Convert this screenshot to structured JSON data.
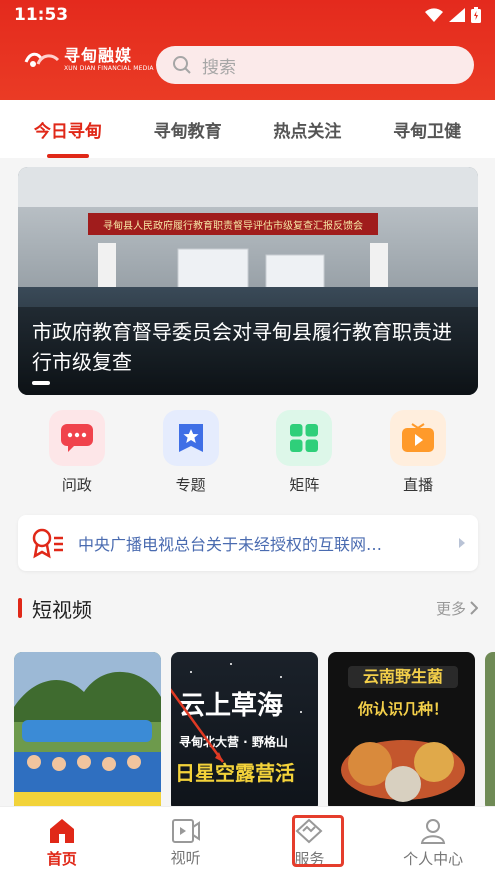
{
  "status": {
    "time": "11:53"
  },
  "header": {
    "logo_main": "寻甸融媒",
    "logo_sub": "XUN DIAN FINANCIAL MEDIA",
    "search_placeholder": "搜索"
  },
  "tabs": [
    {
      "label": "今日寻甸",
      "active": true
    },
    {
      "label": "寻甸教育",
      "active": false
    },
    {
      "label": "热点关注",
      "active": false
    },
    {
      "label": "寻甸卫健",
      "active": false
    }
  ],
  "banner": {
    "caption": "市政府教育督导委员会对寻甸县履行教育职责进行市级复查",
    "screen_text": "寻甸县人民政府履行教育职责督导评估市级复查汇报反馈会"
  },
  "quick_links": [
    {
      "label": "问政",
      "icon": "message-icon",
      "color": "#f0434c"
    },
    {
      "label": "专题",
      "icon": "star-bookmark-icon",
      "color": "#3f6fe6"
    },
    {
      "label": "矩阵",
      "icon": "grid-icon",
      "color": "#2fcf7a"
    },
    {
      "label": "直播",
      "icon": "live-play-icon",
      "color": "#ff9a2a"
    }
  ],
  "notice": {
    "text": "中央广播电视总台关于未经授权的互联网…"
  },
  "short_video": {
    "title": "短视频",
    "more": "更多",
    "cards": [
      {
        "overlay": ""
      },
      {
        "overlay_line1": "云上草海",
        "overlay_line2": "寻甸北大营 · 野格山",
        "overlay_line3": "日星空露营活"
      },
      {
        "overlay_line1": "云南野生菌",
        "overlay_line2": "你认识几种！"
      }
    ]
  },
  "bottom_nav": [
    {
      "label": "首页",
      "icon": "home-icon",
      "active": true
    },
    {
      "label": "视听",
      "icon": "video-play-icon",
      "active": false
    },
    {
      "label": "服务",
      "icon": "service-handshake-icon",
      "active": false
    },
    {
      "label": "个人中心",
      "icon": "person-icon",
      "active": false
    }
  ]
}
